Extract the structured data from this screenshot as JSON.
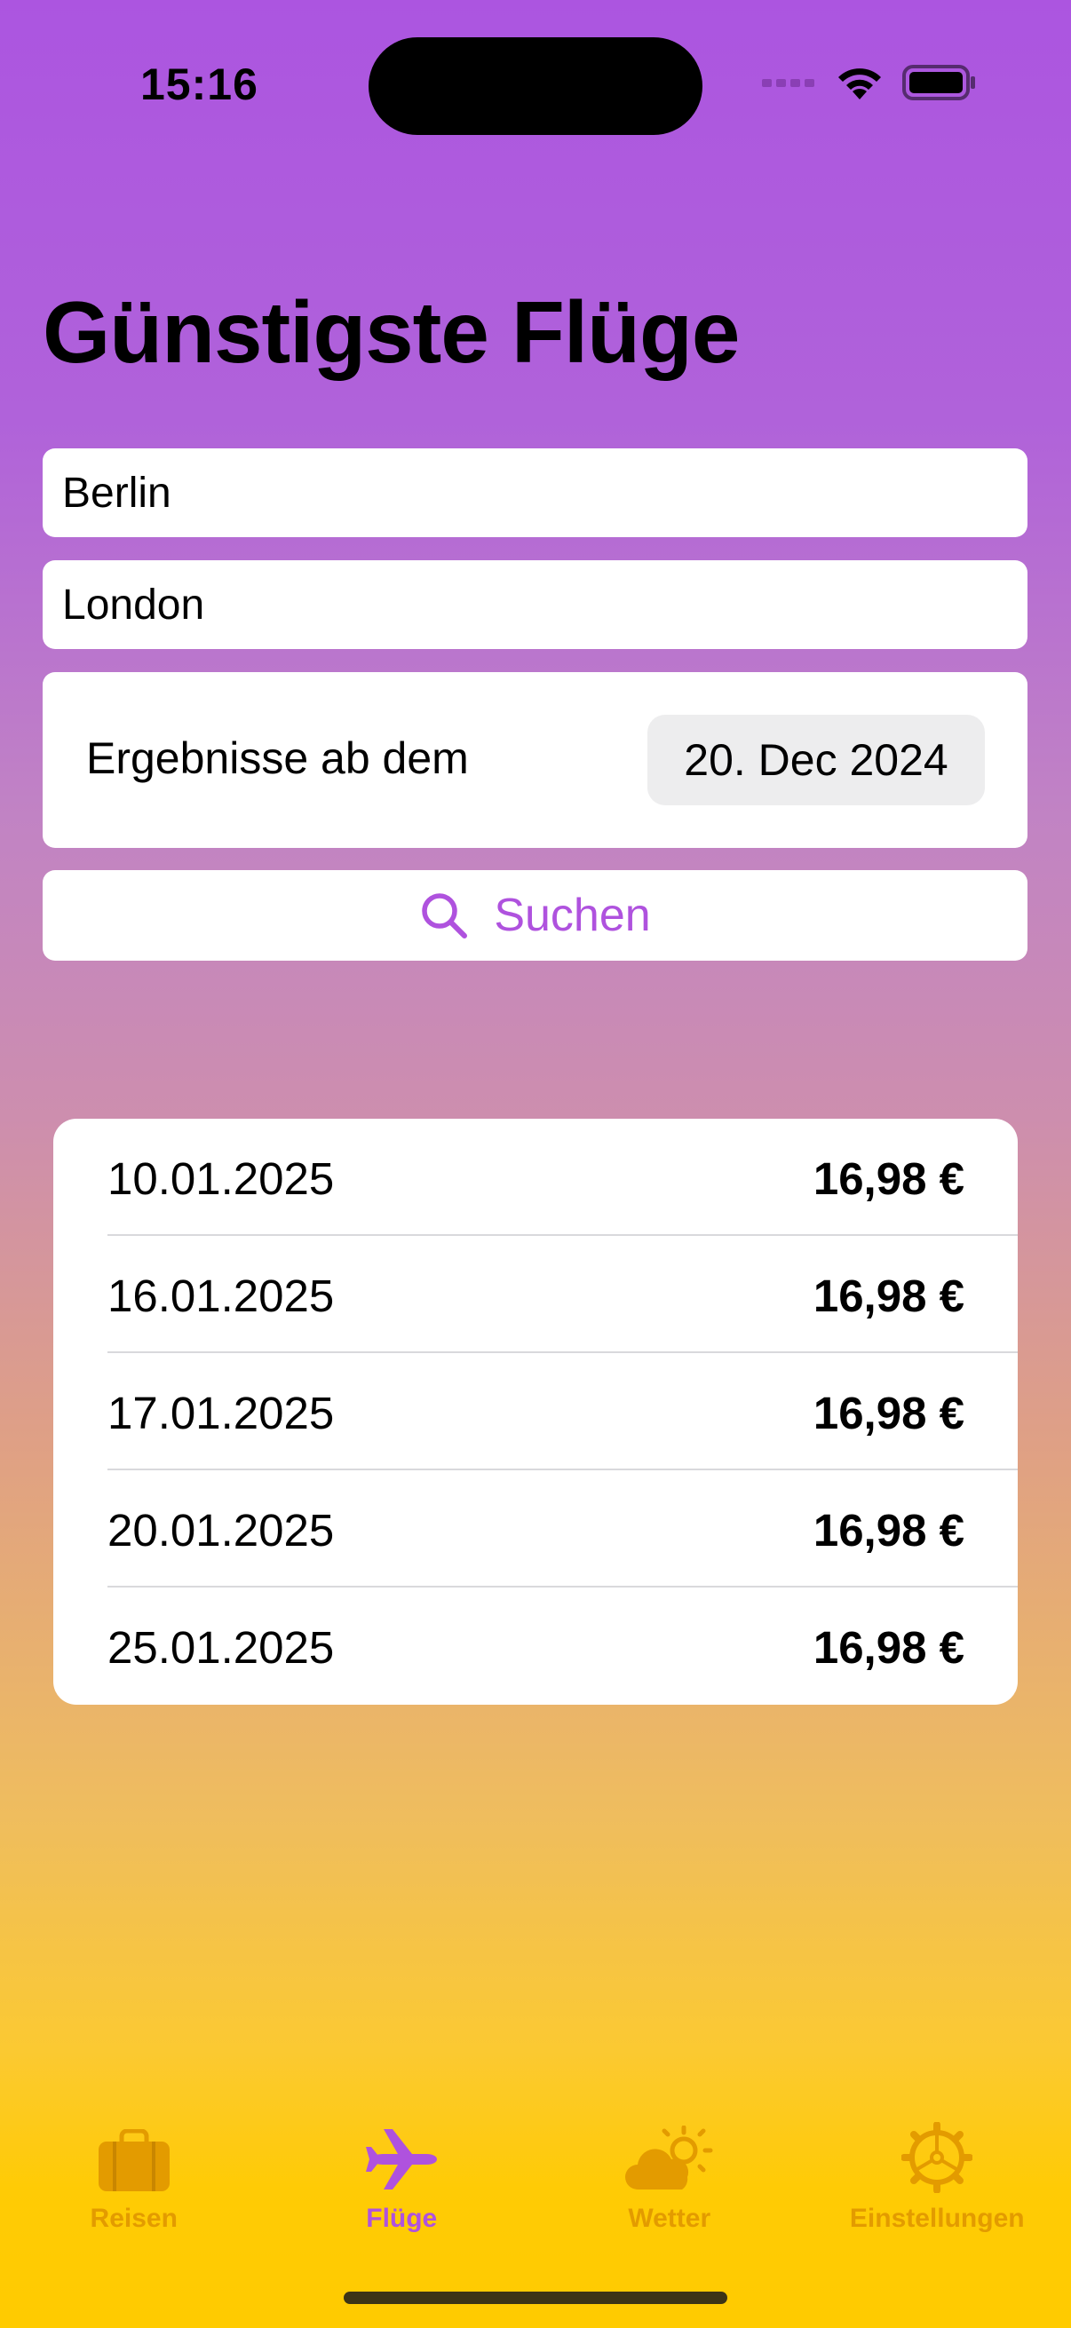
{
  "status_bar": {
    "time": "15:16"
  },
  "page": {
    "title": "Günstigste Flüge"
  },
  "form": {
    "origin_value": "Berlin",
    "destination_value": "London",
    "date_label": "Ergebnisse ab dem",
    "date_value": "20. Dec 2024",
    "search_label": "Suchen"
  },
  "results": [
    {
      "date": "10.01.2025",
      "price": "16,98 €"
    },
    {
      "date": "16.01.2025",
      "price": "16,98 €"
    },
    {
      "date": "17.01.2025",
      "price": "16,98 €"
    },
    {
      "date": "20.01.2025",
      "price": "16,98 €"
    },
    {
      "date": "25.01.2025",
      "price": "16,98 €"
    }
  ],
  "tabbar": {
    "active": "Flüge",
    "items": [
      {
        "label": "Reisen",
        "icon": "suitcase-icon"
      },
      {
        "label": "Flüge",
        "icon": "airplane-icon"
      },
      {
        "label": "Wetter",
        "icon": "cloud-sun-icon"
      },
      {
        "label": "Einstellungen",
        "icon": "gear-icon"
      }
    ]
  },
  "colors": {
    "accent_purple": "#AF52DE",
    "tab_inactive": "#E39B00",
    "gradient_top": "#AC55E0",
    "gradient_bottom": "#FFCB00"
  }
}
